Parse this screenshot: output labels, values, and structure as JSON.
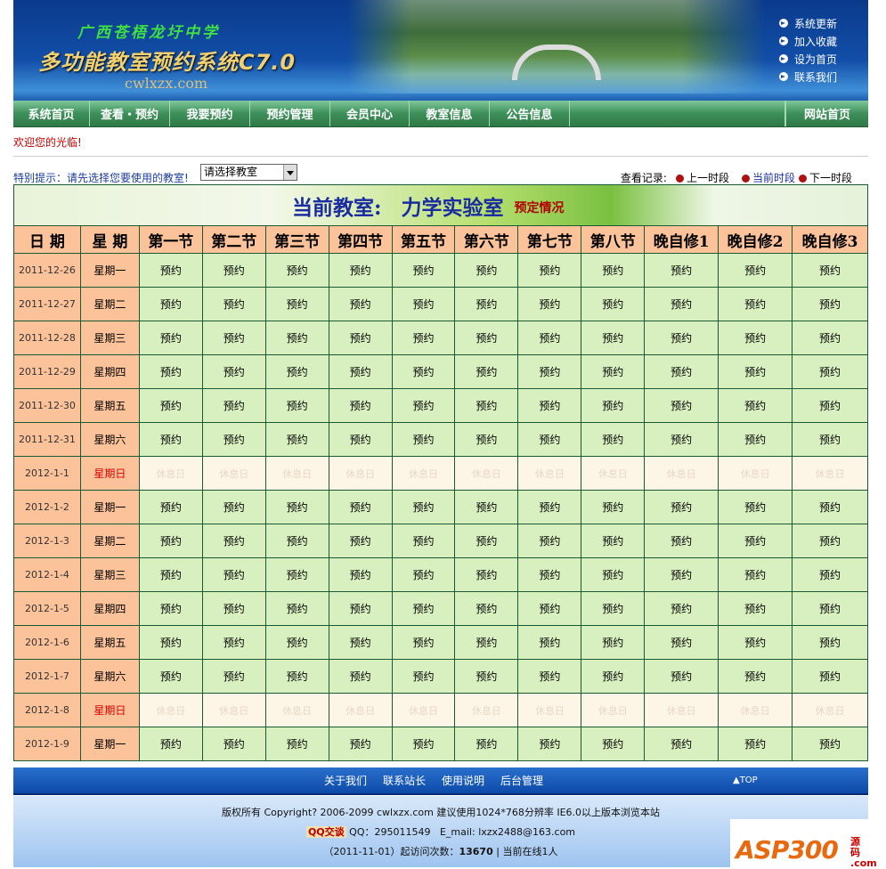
{
  "header": {
    "school": "广西苍梧龙圩中学",
    "system_title": "多功能教室预约系统C7.0",
    "site": "cwlxzx.com",
    "links": [
      "系统更新",
      "加入收藏",
      "设为首页",
      "联系我们"
    ]
  },
  "nav": {
    "items": [
      "系统首页",
      "查看・预约",
      "我要预约",
      "预约管理",
      "会员中心",
      "教室信息",
      "公告信息"
    ],
    "right": "网站首页"
  },
  "welcome": "欢迎您的光临!",
  "hint": "特别提示：请先选择您要使用的教室!",
  "room_select": {
    "value": "请选择教室"
  },
  "records": {
    "label": "查看记录:",
    "prev": "上一时段",
    "current": "当前时段",
    "next": "下一时段"
  },
  "classroom": {
    "label": "当前教室:",
    "name": "力学实验室",
    "status": "预定情况"
  },
  "table": {
    "headers": [
      "日 期",
      "星 期",
      "第一节",
      "第二节",
      "第三节",
      "第四节",
      "第五节",
      "第六节",
      "第七节",
      "第八节",
      "晚自修1",
      "晚自修2",
      "晚自修3"
    ],
    "book_label": "预约",
    "holiday_label": "休息日",
    "rows": [
      {
        "date": "2011-12-26",
        "weekday": "星期一",
        "holiday": false
      },
      {
        "date": "2011-12-27",
        "weekday": "星期二",
        "holiday": false
      },
      {
        "date": "2011-12-28",
        "weekday": "星期三",
        "holiday": false
      },
      {
        "date": "2011-12-29",
        "weekday": "星期四",
        "holiday": false
      },
      {
        "date": "2011-12-30",
        "weekday": "星期五",
        "holiday": false
      },
      {
        "date": "2011-12-31",
        "weekday": "星期六",
        "holiday": false
      },
      {
        "date": "2012-1-1",
        "weekday": "星期日",
        "holiday": true
      },
      {
        "date": "2012-1-2",
        "weekday": "星期一",
        "holiday": false
      },
      {
        "date": "2012-1-3",
        "weekday": "星期二",
        "holiday": false
      },
      {
        "date": "2012-1-4",
        "weekday": "星期三",
        "holiday": false
      },
      {
        "date": "2012-1-5",
        "weekday": "星期四",
        "holiday": false
      },
      {
        "date": "2012-1-6",
        "weekday": "星期五",
        "holiday": false
      },
      {
        "date": "2012-1-7",
        "weekday": "星期六",
        "holiday": false
      },
      {
        "date": "2012-1-8",
        "weekday": "星期日",
        "holiday": true
      },
      {
        "date": "2012-1-9",
        "weekday": "星期一",
        "holiday": false
      }
    ]
  },
  "footer": {
    "links": [
      "关于我们",
      "联系站长",
      "使用说明",
      "后台管理"
    ],
    "top": "▲TOP",
    "copyright": "版权所有 Copyright? 2006-2099 cwlxzx.com 建议使用1024*768分辨率 IE6.0以上版本浏览本站",
    "qq_badge": "QQ交谈",
    "qq": "QQ：295011549",
    "email": "E_mail: lxzx2488@163.com",
    "visits_prefix": "（2011-11-01）起访问次数：",
    "visits": "13670",
    "online": "| 当前在线1人"
  },
  "watermark": {
    "text": "ASP300",
    "sub": "源码 .com"
  }
}
